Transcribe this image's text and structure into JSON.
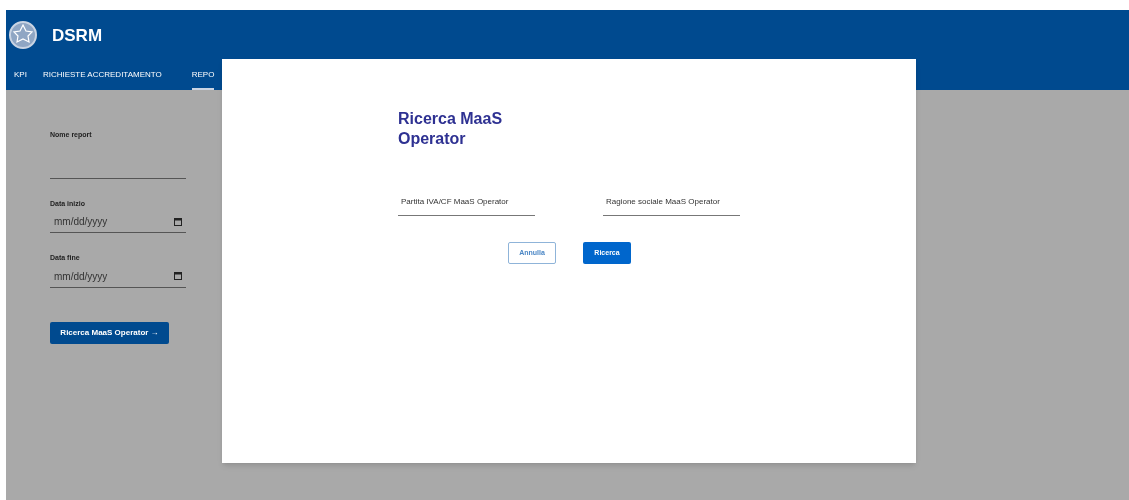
{
  "header": {
    "title": "DSRM"
  },
  "tabs": [
    {
      "label": "KPI",
      "selected": false
    },
    {
      "label": "RICHIESTE ACCREDITAMENTO",
      "selected": false
    },
    {
      "label": "REPO",
      "selected": true
    }
  ],
  "form": {
    "fields": [
      {
        "label": "Nome report",
        "kind": "text"
      },
      {
        "label": "Data inizio",
        "kind": "date",
        "placeholder": "mm/dd/yyyy"
      },
      {
        "label": "Data fine",
        "kind": "date",
        "placeholder": "mm/dd/yyyy"
      }
    ],
    "button": "Ricerca MaaS Operator →"
  },
  "modal": {
    "title": "Ricerca MaaS Operator",
    "fields": [
      {
        "label": "Partita IVA/CF MaaS Operator"
      },
      {
        "label": "Ragione sociale MaaS Operator"
      }
    ],
    "buttons": [
      {
        "label": "Annulla",
        "kind": "secondary"
      },
      {
        "label": "Ricerca",
        "kind": "primary"
      }
    ]
  }
}
